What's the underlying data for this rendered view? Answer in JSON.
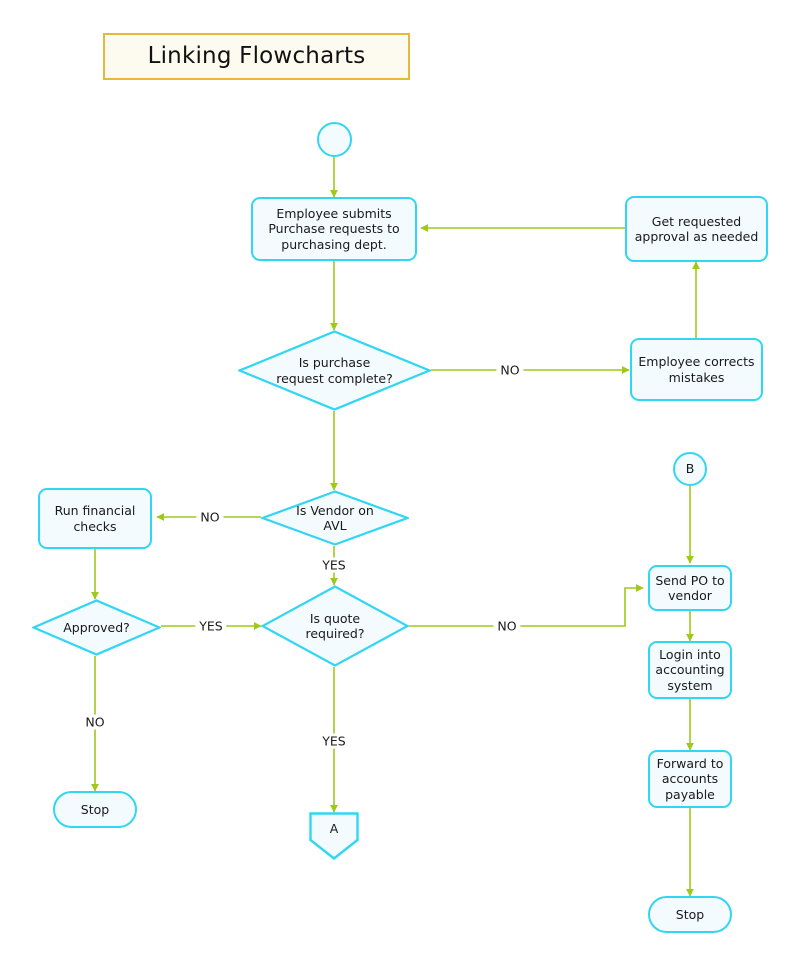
{
  "page": {
    "title": "Linking Flowcharts",
    "background_color": "#ffffff"
  },
  "theme": {
    "title_border_color": "#e8b83b",
    "title_fill_color": "#fdfaf0",
    "node_border_color": "#31d6f2",
    "node_fill_color": "#f3fbfe",
    "connector_color": "#9fc91a",
    "text_color": "#1a1a1a"
  },
  "nodes": {
    "start": {
      "label": "",
      "type": "start-circle"
    },
    "employee_submits": {
      "label": "Employee submits\nPurchase requests to\npurchasing dept.",
      "type": "process"
    },
    "get_approval": {
      "label": "Get requested\napproval as needed",
      "type": "process"
    },
    "request_complete": {
      "label": "Is purchase\nrequest complete?",
      "type": "decision"
    },
    "employee_corrects": {
      "label": "Employee corrects\nmistakes",
      "type": "process"
    },
    "vendor_on_avl": {
      "label": "Is Vendor on\nAVL",
      "type": "decision"
    },
    "run_financial_checks": {
      "label": "Run financial\nchecks",
      "type": "process"
    },
    "approved": {
      "label": "Approved?",
      "type": "decision"
    },
    "quote_required": {
      "label": "Is quote\nrequired?",
      "type": "decision"
    },
    "stop_left": {
      "label": "Stop",
      "type": "terminator"
    },
    "connector_a": {
      "label": "A",
      "type": "offpage-connector"
    },
    "connector_b": {
      "label": "B",
      "type": "connector-circle"
    },
    "send_po": {
      "label": "Send PO to\nvendor",
      "type": "process"
    },
    "login_accounting": {
      "label": "Login into\naccounting\nsystem",
      "type": "process"
    },
    "forward_ap": {
      "label": "Forward to\naccounts\npayable",
      "type": "process"
    },
    "stop_right": {
      "label": "Stop",
      "type": "terminator"
    }
  },
  "edge_labels": {
    "complete_no": "NO",
    "avl_no": "NO",
    "avl_yes": "YES",
    "approved_yes": "YES",
    "approved_no": "NO",
    "quote_no": "NO",
    "quote_yes": "YES"
  }
}
